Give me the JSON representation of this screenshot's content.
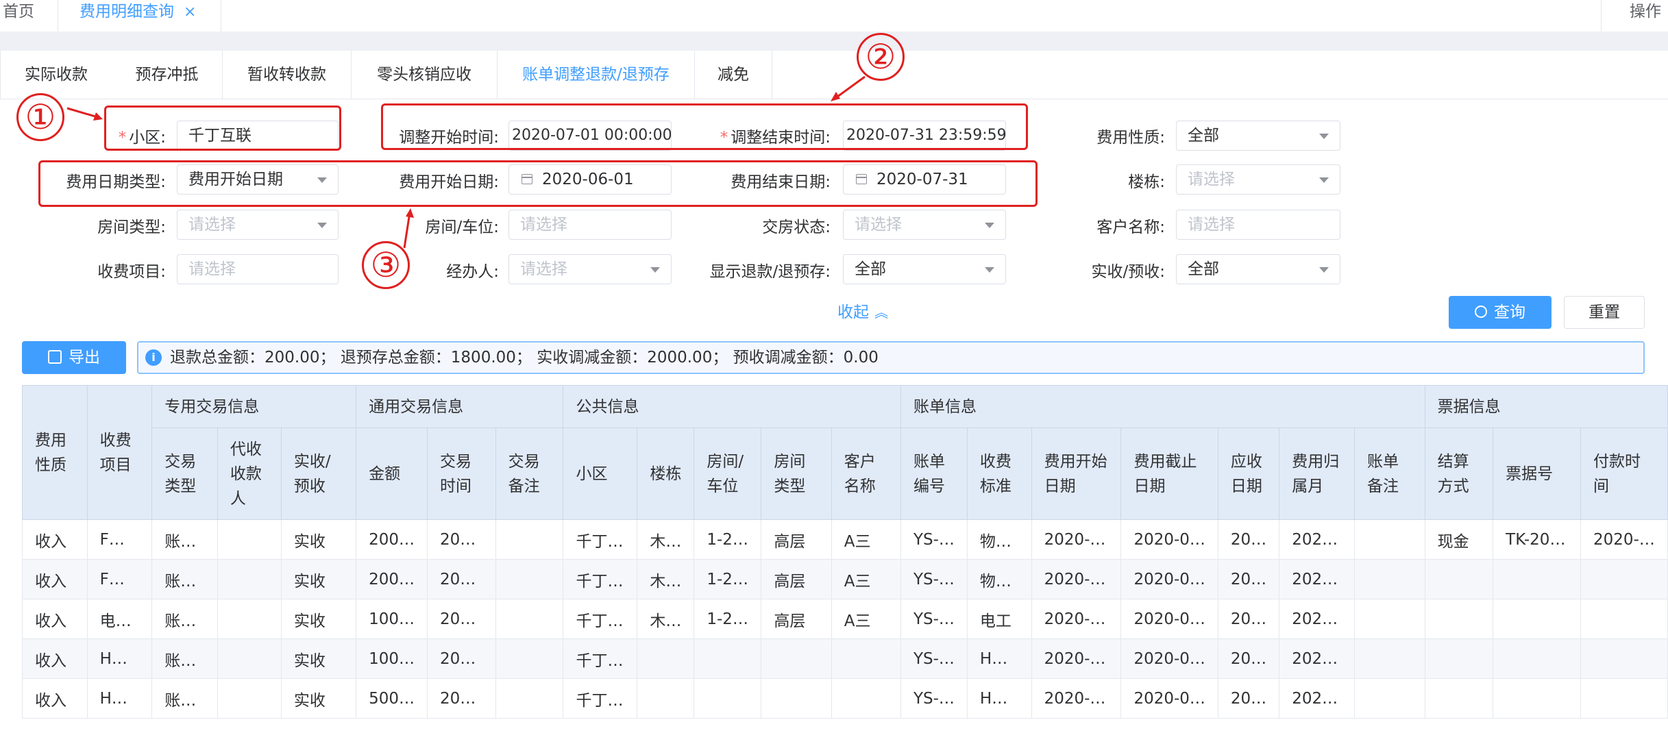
{
  "topnav": {
    "home": "首页",
    "active_tab": "费用明细查询",
    "close": "×",
    "ops": "操作"
  },
  "tabs": [
    "实际收款",
    "预存冲抵",
    "暂收转收款",
    "零头核销应收",
    "账单调整退款/退预存",
    "减免"
  ],
  "form": {
    "community": {
      "label": "小区:",
      "value": "千丁互联"
    },
    "adj_start": {
      "label": "调整开始时间:",
      "value": "2020-07-01 00:00:00"
    },
    "adj_end": {
      "label": "调整结束时间:",
      "value": "2020-07-31 23:59:59"
    },
    "fee_nature": {
      "label": "费用性质:",
      "value": "全部"
    },
    "date_type": {
      "label": "费用日期类型:",
      "value": "费用开始日期"
    },
    "fee_start": {
      "label": "费用开始日期:",
      "value": "2020-06-01"
    },
    "fee_end": {
      "label": "费用结束日期:",
      "value": "2020-07-31"
    },
    "building": {
      "label": "楼栋:",
      "placeholder": "请选择"
    },
    "room_type": {
      "label": "房间类型:",
      "placeholder": "请选择"
    },
    "room": {
      "label": "房间/车位:",
      "placeholder": "请选择"
    },
    "delivery": {
      "label": "交房状态:",
      "placeholder": "请选择"
    },
    "customer": {
      "label": "客户名称:",
      "placeholder": "请选择"
    },
    "fee_item": {
      "label": "收费项目:",
      "placeholder": "请选择"
    },
    "handler": {
      "label": "经办人:",
      "placeholder": "请选择"
    },
    "show_refund": {
      "label": "显示退款/退预存:",
      "value": "全部"
    },
    "recv": {
      "label": "实收/预收:",
      "value": "全部"
    }
  },
  "annotations": [
    "①",
    "②",
    "③"
  ],
  "actions": {
    "collapse": "收起",
    "search": "查询",
    "reset": "重置",
    "export": "导出"
  },
  "summary": "退款总金额：200.00；  退预存总金额：1800.00；  实收调减金额：2000.00；  预收调减金额：0.00",
  "table": {
    "groups": [
      "专用交易信息",
      "通用交易信息",
      "公共信息",
      "账单信息",
      "票据信息"
    ],
    "top_headers": [
      "费用性质",
      "收费项目"
    ],
    "sub_headers": [
      "交易类型",
      "代收收款人",
      "实收/预收",
      "金额",
      "交易时间",
      "交易备注",
      "小区",
      "楼栋",
      "房间/车位",
      "房间类型",
      "客户名称",
      "账单编号",
      "收费标准",
      "费用开始日期",
      "费用截止日期",
      "应收日期",
      "费用归属月",
      "账单备注",
      "结算方式",
      "票据号",
      "付款时间"
    ],
    "rows": [
      [
        "收入",
        "F…",
        "账…",
        "",
        "实收",
        "200…",
        "20…",
        "",
        "千丁…",
        "木…",
        "1-2…",
        "高层",
        "A三",
        "YS-…",
        "物…",
        "2020-…",
        "2020-0…",
        "20…",
        "202…",
        "",
        "现金",
        "TK-20…",
        "2020-…"
      ],
      [
        "收入",
        "F…",
        "账…",
        "",
        "实收",
        "200…",
        "20…",
        "",
        "千丁…",
        "木…",
        "1-2…",
        "高层",
        "A三",
        "YS-…",
        "物…",
        "2020-…",
        "2020-0…",
        "20…",
        "202…",
        "",
        "",
        "",
        ""
      ],
      [
        "收入",
        "电…",
        "账…",
        "",
        "实收",
        "100…",
        "20…",
        "",
        "千丁…",
        "木…",
        "1-2…",
        "高层",
        "A三",
        "YS-…",
        "电工",
        "2020-…",
        "2020-0…",
        "20…",
        "202…",
        "",
        "",
        "",
        ""
      ],
      [
        "收入",
        "H…",
        "账…",
        "",
        "实收",
        "100…",
        "20…",
        "",
        "千丁…",
        "",
        "",
        "",
        "",
        "YS-…",
        "H…",
        "2020-…",
        "2020-0…",
        "20…",
        "202…",
        "",
        "",
        "",
        ""
      ],
      [
        "收入",
        "H…",
        "账…",
        "",
        "实收",
        "500…",
        "20…",
        "",
        "千丁…",
        "",
        "",
        "",
        "",
        "YS-…",
        "H…",
        "2020-…",
        "2020-0…",
        "20…",
        "202…",
        "",
        "",
        "",
        ""
      ]
    ]
  }
}
